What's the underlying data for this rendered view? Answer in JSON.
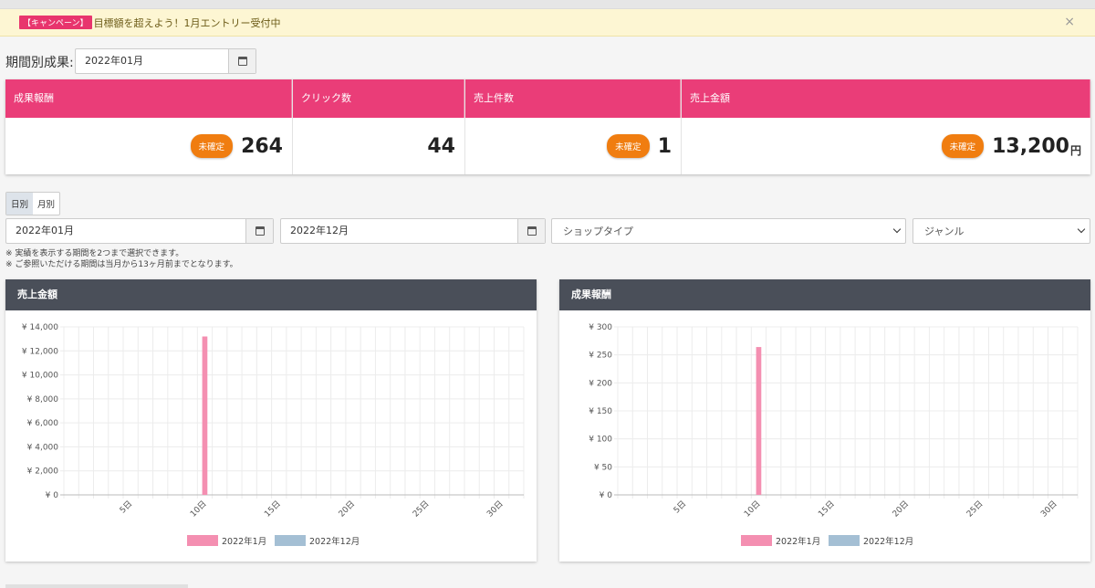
{
  "banner": {
    "tag": "【キャンペーン】",
    "text": "目標額を超えよう！1月エントリー受付中",
    "close": "×"
  },
  "period": {
    "label": "期間別成果:",
    "value": "2022年01月"
  },
  "stats": [
    {
      "header": "成果報酬",
      "badge": "未確定",
      "value": "264",
      "unit": ""
    },
    {
      "header": "クリック数",
      "badge": "",
      "value": "44",
      "unit": ""
    },
    {
      "header": "売上件数",
      "badge": "未確定",
      "value": "1",
      "unit": ""
    },
    {
      "header": "売上金額",
      "badge": "未確定",
      "value": "13,200",
      "unit": "円"
    }
  ],
  "toggle": {
    "daily": "日別",
    "monthly": "月別"
  },
  "filters": {
    "start": "2022年01月",
    "end": "2022年12月",
    "shop_type": "ショップタイプ",
    "genre": "ジャンル"
  },
  "notes": [
    "※ 実績を表示する期間を2つまで選択できます。",
    "※ ご参照いただける期間は当月から13ヶ月前までとなります。"
  ],
  "colors": {
    "accent": "#ea3d78",
    "series1": "#f48fb1",
    "series2": "#a4bfd4",
    "header_dark": "#4a4f59",
    "badge": "#f07d10"
  },
  "chart_data": [
    {
      "type": "bar",
      "title": "売上金額",
      "x": [
        1,
        2,
        3,
        4,
        5,
        6,
        7,
        8,
        9,
        10,
        11,
        12,
        13,
        14,
        15,
        16,
        17,
        18,
        19,
        20,
        21,
        22,
        23,
        24,
        25,
        26,
        27,
        28,
        29,
        30,
        31
      ],
      "xticks": [
        "5日",
        "10日",
        "15日",
        "20日",
        "25日",
        "30日"
      ],
      "xtick_values": [
        5,
        10,
        15,
        20,
        25,
        30
      ],
      "yticks": [
        "¥ 0",
        "¥ 2,000",
        "¥ 4,000",
        "¥ 6,000",
        "¥ 8,000",
        "¥ 10,000",
        "¥ 12,000",
        "¥ 14,000"
      ],
      "ylim": [
        0,
        14000
      ],
      "series": [
        {
          "name": "2022年1月",
          "color": "#f48fb1",
          "values": [
            0,
            0,
            0,
            0,
            0,
            0,
            0,
            0,
            0,
            13200,
            0,
            0,
            0,
            0,
            0,
            0,
            0,
            0,
            0,
            0,
            0,
            0,
            0,
            0,
            0,
            0,
            0,
            0,
            0,
            0,
            0
          ]
        },
        {
          "name": "2022年12月",
          "color": "#a4bfd4",
          "values": [
            0,
            0,
            0,
            0,
            0,
            0,
            0,
            0,
            0,
            0,
            0,
            0,
            0,
            0,
            0,
            0,
            0,
            0,
            0,
            0,
            0,
            0,
            0,
            0,
            0,
            0,
            0,
            0,
            0,
            0,
            0
          ]
        }
      ],
      "legend": "bottom",
      "grid": true
    },
    {
      "type": "bar",
      "title": "成果報酬",
      "x": [
        1,
        2,
        3,
        4,
        5,
        6,
        7,
        8,
        9,
        10,
        11,
        12,
        13,
        14,
        15,
        16,
        17,
        18,
        19,
        20,
        21,
        22,
        23,
        24,
        25,
        26,
        27,
        28,
        29,
        30,
        31
      ],
      "xticks": [
        "5日",
        "10日",
        "15日",
        "20日",
        "25日",
        "30日"
      ],
      "xtick_values": [
        5,
        10,
        15,
        20,
        25,
        30
      ],
      "yticks": [
        "¥ 0",
        "¥ 50",
        "¥ 100",
        "¥ 150",
        "¥ 200",
        "¥ 250",
        "¥ 300"
      ],
      "ylim": [
        0,
        300
      ],
      "series": [
        {
          "name": "2022年1月",
          "color": "#f48fb1",
          "values": [
            0,
            0,
            0,
            0,
            0,
            0,
            0,
            0,
            0,
            264,
            0,
            0,
            0,
            0,
            0,
            0,
            0,
            0,
            0,
            0,
            0,
            0,
            0,
            0,
            0,
            0,
            0,
            0,
            0,
            0,
            0
          ]
        },
        {
          "name": "2022年12月",
          "color": "#a4bfd4",
          "values": [
            0,
            0,
            0,
            0,
            0,
            0,
            0,
            0,
            0,
            0,
            0,
            0,
            0,
            0,
            0,
            0,
            0,
            0,
            0,
            0,
            0,
            0,
            0,
            0,
            0,
            0,
            0,
            0,
            0,
            0,
            0
          ]
        }
      ],
      "legend": "bottom",
      "grid": true
    }
  ]
}
